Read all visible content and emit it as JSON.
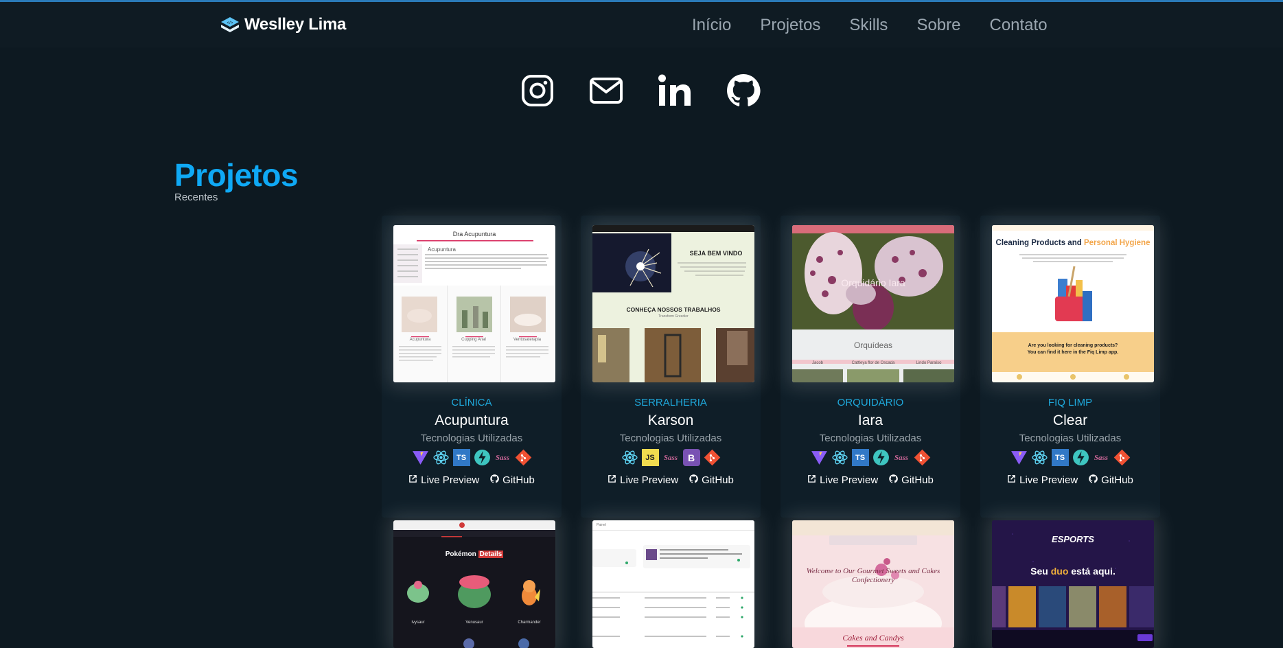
{
  "brand": {
    "name": "Weslley Lima"
  },
  "nav": {
    "items": [
      "Início",
      "Projetos",
      "Skills",
      "Sobre",
      "Contato"
    ]
  },
  "socials": [
    "instagram-icon",
    "mail-icon",
    "linkedin-icon",
    "github-icon"
  ],
  "section": {
    "title": "Projetos",
    "subtitle": "Recentes"
  },
  "projects": [
    {
      "category": "CLÍNICA",
      "name": "Acupuntura",
      "tech_label": "Tecnologias Utilizadas",
      "live": "Live Preview",
      "github": "GitHub",
      "techs": [
        "vite",
        "react",
        "ts",
        "stitches",
        "sass",
        "git"
      ],
      "thumb": {
        "brand": "Dra Acupuntura",
        "heading": "Acupuntura",
        "items": [
          "Acupuntura",
          "Cupping Anal",
          "Ventosaterapia"
        ]
      }
    },
    {
      "category": "SERRALHERIA",
      "name": "Karson",
      "tech_label": "Tecnologias Utilizadas",
      "live": "Live Preview",
      "github": "GitHub",
      "techs": [
        "react",
        "js",
        "sass",
        "bootstrap",
        "git"
      ],
      "thumb": {
        "welcome": "SEJA BEM VINDO",
        "works": "CONHEÇA NOSSOS TRABALHOS",
        "works_sub": "Transform Greedier"
      }
    },
    {
      "category": "ORQUIDÁRIO",
      "name": "Iara",
      "tech_label": "Tecnologias Utilizadas",
      "live": "Live Preview",
      "github": "GitHub",
      "techs": [
        "vite",
        "react",
        "ts",
        "stitches",
        "sass",
        "git"
      ],
      "thumb": {
        "hero": "Orquidário Iara",
        "section": "Orquídeas",
        "tags": [
          "Jacob",
          "Cattleya flor de Oscada",
          "Lindo Paraíso"
        ]
      }
    },
    {
      "category": "FIQ LIMP",
      "name": "Clear",
      "tech_label": "Tecnologias Utilizadas",
      "live": "Live Preview",
      "github": "GitHub",
      "techs": [
        "vite",
        "react",
        "ts",
        "stitches",
        "sass",
        "git"
      ],
      "thumb": {
        "headline_a": "Cleaning Products and ",
        "headline_b": "Personal Hygiene",
        "question": "Are you looking for cleaning products?",
        "answer": "You can find it here in the Fiq Limp app."
      }
    }
  ],
  "projects_row2": [
    {
      "thumb": {
        "title_a": "Pokémon ",
        "title_b": "Details",
        "names": [
          "Ivysaur",
          "Venusaur",
          "Charmander"
        ]
      }
    },
    {
      "thumb": {
        "label": "Painel"
      }
    },
    {
      "thumb": {
        "hero": "Welcome to Our Gourmet Sweets and Cakes Confectionery",
        "section": "Cakes and Candys"
      }
    },
    {
      "thumb": {
        "logo": "ESPORTS",
        "headline_a": "Seu ",
        "headline_b": "duo",
        "headline_c": " está aqui."
      }
    }
  ],
  "colors": {
    "accent": "#0fa9f5",
    "category": "#1fa9dc",
    "background": "#0d1921"
  }
}
